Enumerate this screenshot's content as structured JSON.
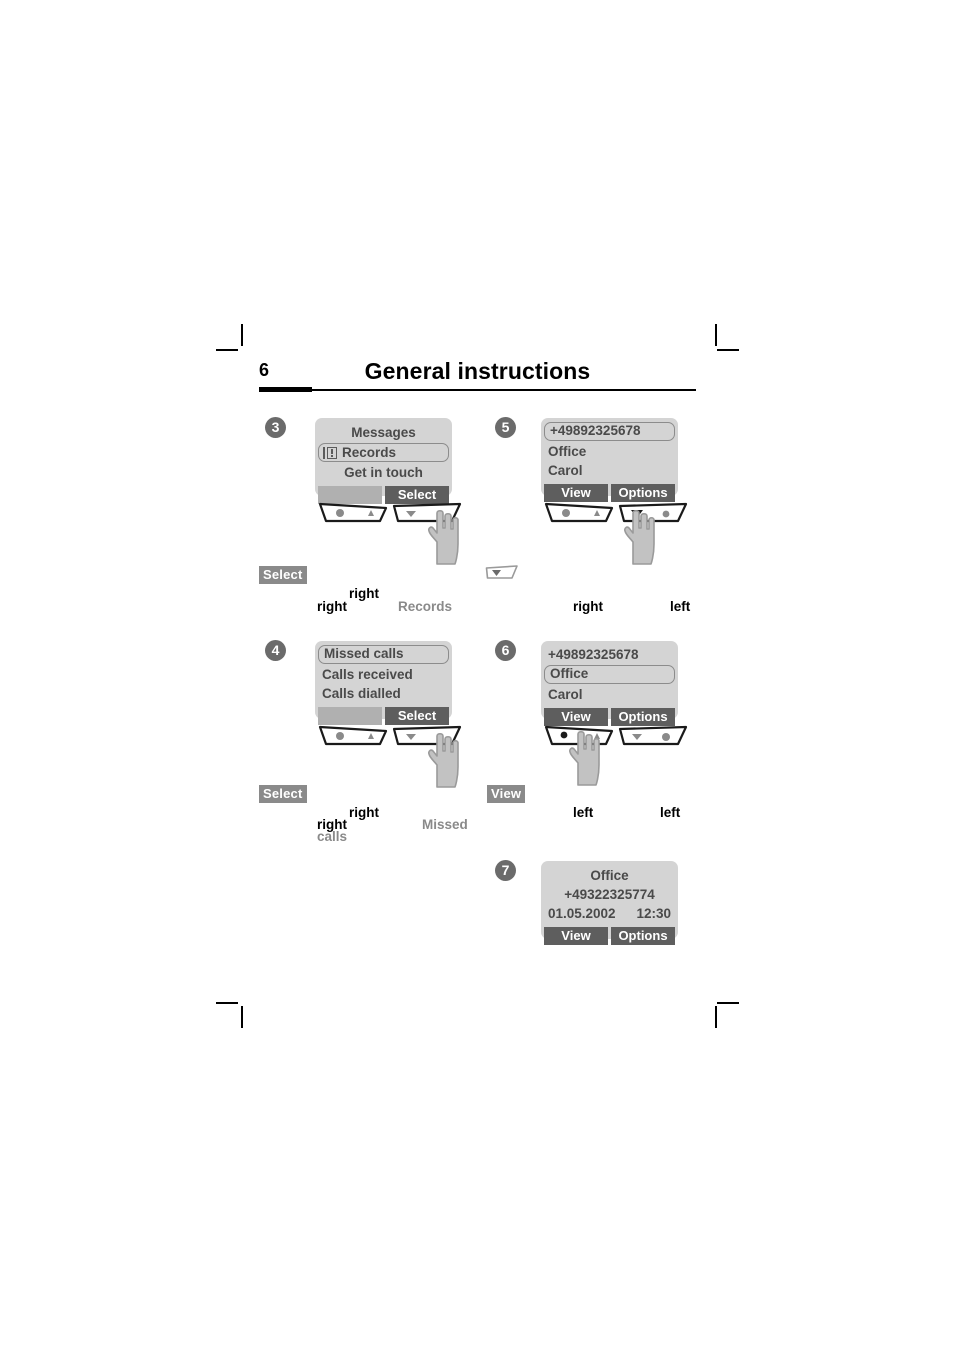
{
  "header": {
    "page_number": "6",
    "title": "General instructions"
  },
  "steps": [
    {
      "badge": "3",
      "screen": {
        "lines": [
          {
            "text": "Messages",
            "style": "center"
          },
          {
            "text": "Records",
            "style": "selected-icon",
            "icon": "records-icon"
          },
          {
            "text": "Get in touch",
            "style": "center"
          }
        ],
        "softkeys": [
          {
            "label": "",
            "empty": true
          },
          {
            "label": "Select",
            "empty": false
          }
        ]
      },
      "keys": {
        "left": {
          "glyph_left": "dot",
          "glyph_right": "up"
        },
        "right": {
          "glyph_left": "down",
          "glyph_right": "dot"
        },
        "pressed": "right-dot"
      },
      "caption": {
        "chip": "Select",
        "words": [
          "right",
          "right",
          "Records"
        ]
      }
    },
    {
      "badge": "4",
      "screen": {
        "lines": [
          {
            "text": "Missed calls",
            "style": "selected"
          },
          {
            "text": "Calls received",
            "style": "plain"
          },
          {
            "text": "Calls dialled",
            "style": "plain"
          }
        ],
        "softkeys": [
          {
            "label": "",
            "empty": true
          },
          {
            "label": "Select",
            "empty": false
          }
        ]
      },
      "keys": {
        "left": {
          "glyph_left": "dot",
          "glyph_right": "up"
        },
        "right": {
          "glyph_left": "down",
          "glyph_right": "dot"
        },
        "pressed": "right-dot"
      },
      "caption": {
        "chip": "Select",
        "words": [
          "right",
          "right",
          "Missed",
          "calls"
        ]
      }
    },
    {
      "badge": "5",
      "screen": {
        "lines": [
          {
            "text": "+49892325678",
            "style": "selected"
          },
          {
            "text": "Office",
            "style": "plain"
          },
          {
            "text": "Carol",
            "style": "plain"
          }
        ],
        "softkeys": [
          {
            "label": "View",
            "empty": false
          },
          {
            "label": "Options",
            "empty": false
          }
        ]
      },
      "keys": {
        "left": {
          "glyph_left": "dot",
          "glyph_right": "up"
        },
        "right": {
          "glyph_left": "down",
          "glyph_right": "dot"
        },
        "pressed": "right-down"
      },
      "caption": {
        "chip": "",
        "minikey": "down-key-icon",
        "words": [
          "right",
          "left"
        ]
      }
    },
    {
      "badge": "6",
      "screen": {
        "lines": [
          {
            "text": "+49892325678",
            "style": "plain"
          },
          {
            "text": "Office",
            "style": "selected"
          },
          {
            "text": "Carol",
            "style": "plain"
          }
        ],
        "softkeys": [
          {
            "label": "View",
            "empty": false
          },
          {
            "label": "Options",
            "empty": false
          }
        ]
      },
      "keys": {
        "left": {
          "glyph_left": "dot",
          "glyph_right": "up"
        },
        "right": {
          "glyph_left": "down",
          "glyph_right": "dot"
        },
        "pressed": "left-dot"
      },
      "caption": {
        "chip": "View",
        "words": [
          "left",
          "left"
        ]
      }
    },
    {
      "badge": "7",
      "screen": {
        "lines": [
          {
            "text": "Office",
            "style": "center"
          },
          {
            "text": "+49322325774",
            "style": "center"
          },
          {
            "text": "01.05.2002",
            "text2": "12:30",
            "style": "split"
          }
        ],
        "softkeys": [
          {
            "label": "View",
            "empty": false
          },
          {
            "label": "Options",
            "empty": false
          }
        ]
      }
    }
  ],
  "colors": {
    "screen_bg": "#d4d4d4",
    "softkey_active": "#5e5e5e",
    "softkey_empty": "#b0b0b0",
    "badge": "#6b6b6b",
    "text": "#4a4a4a",
    "caption_gray": "#8a8a8a"
  }
}
